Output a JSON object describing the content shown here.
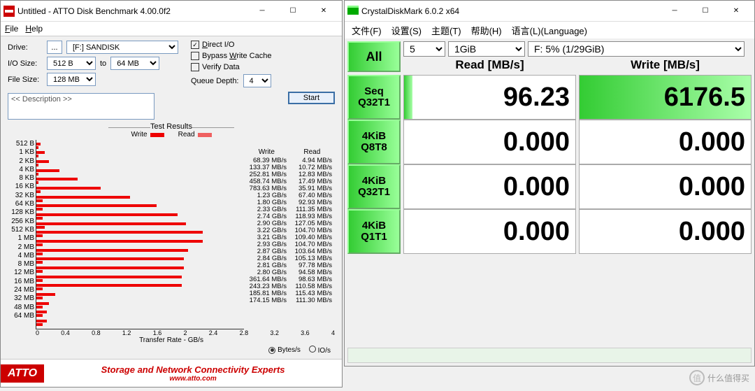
{
  "atto": {
    "title": "Untitled - ATTO Disk Benchmark 4.00.0f2",
    "menu": {
      "file": "File",
      "help": "Help"
    },
    "labels": {
      "drive": "Drive:",
      "iosize": "I/O Size:",
      "to": "to",
      "filesize": "File Size:",
      "directio": "Direct I/O",
      "bypass": "Bypass Write Cache",
      "verify": "Verify Data",
      "qdepth": "Queue Depth:",
      "start": "Start",
      "description": "<< Description >>",
      "testresults": "Test Results",
      "write": "Write",
      "read": "Read",
      "xaxis": "Transfer Rate - GB/s",
      "bytes_s": "Bytes/s",
      "io_s": "IO/s"
    },
    "drive_btn": "...",
    "drive_val": "[F:] SANDISK",
    "io_from": "512 B",
    "io_to": "64 MB",
    "filesize": "128 MB",
    "qdepth": "4",
    "directio_checked": true,
    "xticks": [
      "0",
      "0.4",
      "0.8",
      "1.2",
      "1.6",
      "2",
      "2.4",
      "2.8",
      "3.2",
      "3.6",
      "4"
    ],
    "rows": [
      {
        "label": "512 B",
        "write": "68.39 MB/s",
        "read": "4.94 MB/s",
        "wb": 2,
        "rb": 1
      },
      {
        "label": "1 KB",
        "write": "133.37 MB/s",
        "read": "10.72 MB/s",
        "wb": 4,
        "rb": 1
      },
      {
        "label": "2 KB",
        "write": "252.81 MB/s",
        "read": "12.83 MB/s",
        "wb": 6,
        "rb": 1
      },
      {
        "label": "4 KB",
        "write": "458.74 MB/s",
        "read": "17.49 MB/s",
        "wb": 11,
        "rb": 1
      },
      {
        "label": "8 KB",
        "write": "783.63 MB/s",
        "read": "35.91 MB/s",
        "wb": 20,
        "rb": 1
      },
      {
        "label": "16 KB",
        "write": "1.23 GB/s",
        "read": "67.40 MB/s",
        "wb": 31,
        "rb": 2
      },
      {
        "label": "32 KB",
        "write": "1.80 GB/s",
        "read": "92.93 MB/s",
        "wb": 45,
        "rb": 3
      },
      {
        "label": "64 KB",
        "write": "2.33 GB/s",
        "read": "111.35 MB/s",
        "wb": 58,
        "rb": 3
      },
      {
        "label": "128 KB",
        "write": "2.74 GB/s",
        "read": "118.93 MB/s",
        "wb": 68,
        "rb": 3
      },
      {
        "label": "256 KB",
        "write": "2.90 GB/s",
        "read": "127.05 MB/s",
        "wb": 72,
        "rb": 4
      },
      {
        "label": "512 KB",
        "write": "3.22 GB/s",
        "read": "104.70 MB/s",
        "wb": 80,
        "rb": 3
      },
      {
        "label": "1 MB",
        "write": "3.21 GB/s",
        "read": "109.40 MB/s",
        "wb": 80,
        "rb": 3
      },
      {
        "label": "2 MB",
        "write": "2.93 GB/s",
        "read": "104.70 MB/s",
        "wb": 73,
        "rb": 3
      },
      {
        "label": "4 MB",
        "write": "2.87 GB/s",
        "read": "103.64 MB/s",
        "wb": 71,
        "rb": 3
      },
      {
        "label": "8 MB",
        "write": "2.84 GB/s",
        "read": "105.13 MB/s",
        "wb": 71,
        "rb": 3
      },
      {
        "label": "12 MB",
        "write": "2.81 GB/s",
        "read": "97.78 MB/s",
        "wb": 70,
        "rb": 3
      },
      {
        "label": "16 MB",
        "write": "2.80 GB/s",
        "read": "94.58 MB/s",
        "wb": 70,
        "rb": 3
      },
      {
        "label": "24 MB",
        "write": "361.64 MB/s",
        "read": "98.63 MB/s",
        "wb": 9,
        "rb": 3
      },
      {
        "label": "32 MB",
        "write": "243.23 MB/s",
        "read": "110.58 MB/s",
        "wb": 6,
        "rb": 3
      },
      {
        "label": "48 MB",
        "write": "185.81 MB/s",
        "read": "115.43 MB/s",
        "wb": 5,
        "rb": 3
      },
      {
        "label": "64 MB",
        "write": "174.15 MB/s",
        "read": "111.30 MB/s",
        "wb": 5,
        "rb": 3
      }
    ],
    "footer": {
      "logo": "ATTO",
      "slogan": "Storage and Network Connectivity Experts",
      "url": "www.atto.com"
    }
  },
  "chart_data": {
    "type": "bar",
    "title": "Test Results",
    "xlabel": "Transfer Rate - GB/s",
    "xlim": [
      0,
      4
    ],
    "categories": [
      "512 B",
      "1 KB",
      "2 KB",
      "4 KB",
      "8 KB",
      "16 KB",
      "32 KB",
      "64 KB",
      "128 KB",
      "256 KB",
      "512 KB",
      "1 MB",
      "2 MB",
      "4 MB",
      "8 MB",
      "12 MB",
      "16 MB",
      "24 MB",
      "32 MB",
      "48 MB",
      "64 MB"
    ],
    "series": [
      {
        "name": "Write",
        "unit": "GB/s",
        "values": [
          0.068,
          0.133,
          0.253,
          0.459,
          0.784,
          1.23,
          1.8,
          2.33,
          2.74,
          2.9,
          3.22,
          3.21,
          2.93,
          2.87,
          2.84,
          2.81,
          2.8,
          0.362,
          0.243,
          0.186,
          0.174
        ]
      },
      {
        "name": "Read",
        "unit": "GB/s",
        "values": [
          0.0049,
          0.0107,
          0.0128,
          0.0175,
          0.0359,
          0.0674,
          0.0929,
          0.1114,
          0.1189,
          0.1271,
          0.1047,
          0.1094,
          0.1047,
          0.1036,
          0.1051,
          0.0978,
          0.0946,
          0.0986,
          0.1106,
          0.1154,
          0.1113
        ]
      }
    ]
  },
  "cdm": {
    "title": "CrystalDiskMark 6.0.2 x64",
    "menu": {
      "file": "文件(F)",
      "settings": "设置(S)",
      "theme": "主题(T)",
      "help": "帮助(H)",
      "language": "语言(L)(Language)"
    },
    "all": "All",
    "count": "5",
    "size": "1GiB",
    "drive": "F: 5% (1/29GiB)",
    "read_hdr": "Read [MB/s]",
    "write_hdr": "Write [MB/s]",
    "rows": [
      {
        "btn1": "Seq",
        "btn2": "Q32T1",
        "read": "96.23",
        "write": "6176.5",
        "rfill": 5,
        "wfill": 100
      },
      {
        "btn1": "4KiB",
        "btn2": "Q8T8",
        "read": "0.000",
        "write": "0.000",
        "rfill": 0,
        "wfill": 0
      },
      {
        "btn1": "4KiB",
        "btn2": "Q32T1",
        "read": "0.000",
        "write": "0.000",
        "rfill": 0,
        "wfill": 0
      },
      {
        "btn1": "4KiB",
        "btn2": "Q1T1",
        "read": "0.000",
        "write": "0.000",
        "rfill": 0,
        "wfill": 0
      }
    ]
  },
  "watermark": "什么值得买"
}
